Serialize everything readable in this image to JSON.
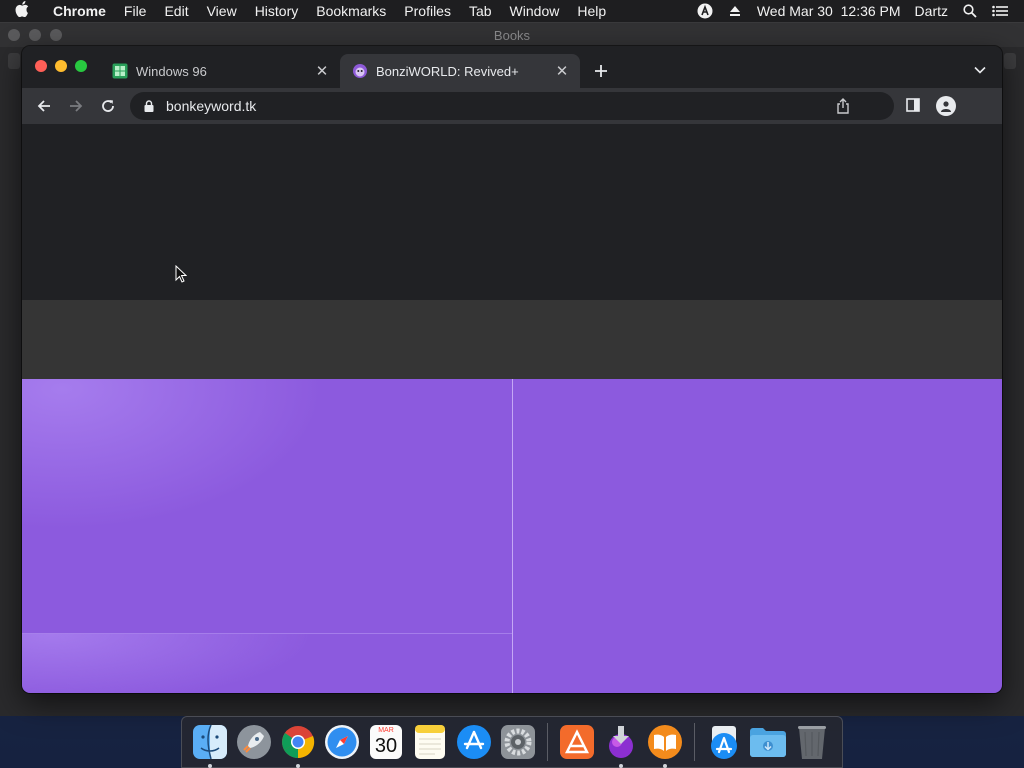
{
  "menubar": {
    "app_name": "Chrome",
    "items": [
      "File",
      "Edit",
      "View",
      "History",
      "Bookmarks",
      "Profiles",
      "Tab",
      "Window",
      "Help"
    ],
    "datetime": "Wed Mar 30  12:36 PM",
    "user": "Dartz",
    "icons": [
      "apple-icon",
      "accessibility-icon",
      "eject-icon",
      "spotlight-search-icon",
      "control-center-icon"
    ]
  },
  "books_window": {
    "title": "Books"
  },
  "chrome": {
    "tabs": [
      {
        "title": "Windows 96",
        "favicon": "windows96-favicon",
        "active": false
      },
      {
        "title": "BonziWORLD: Revived+",
        "favicon": "bonzi-favicon",
        "active": true
      }
    ],
    "url": "bonkeyword.tk"
  },
  "colors": {
    "page_dark": "#202124",
    "page_grey": "#353535",
    "page_purple": "#8c5ade",
    "toolbar": "#35363a"
  },
  "dock": {
    "calendar": {
      "month": "MAR",
      "day": "30"
    },
    "apps": [
      "Finder",
      "Launchpad",
      "Google Chrome",
      "Safari",
      "Calendar",
      "Notes",
      "App Store",
      "System Preferences",
      "Affinity",
      "Downloader",
      "Books",
      "Xcode Installer",
      "Folder",
      "Trash"
    ]
  }
}
